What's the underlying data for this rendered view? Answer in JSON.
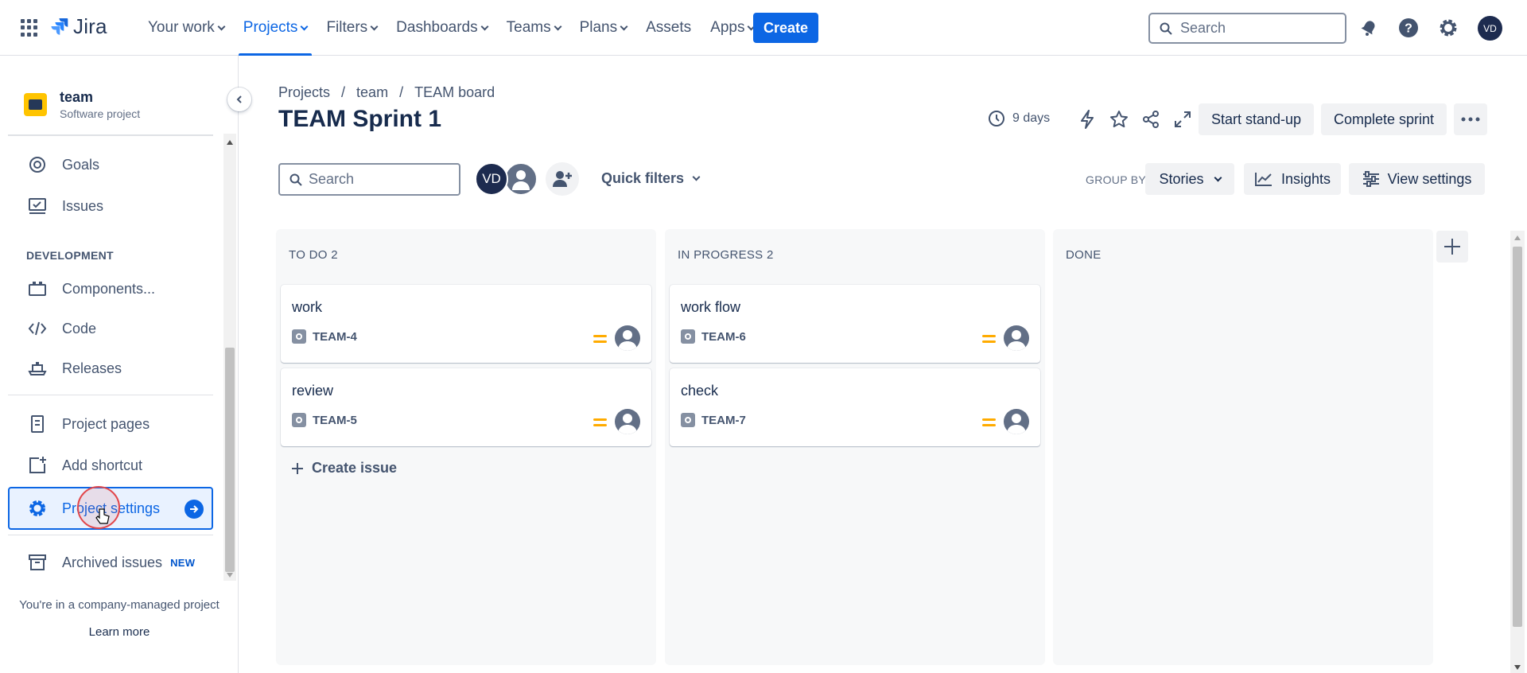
{
  "topnav": {
    "product": "Jira",
    "items": [
      {
        "label": "Your work",
        "dropdown": true
      },
      {
        "label": "Projects",
        "dropdown": true,
        "active": true
      },
      {
        "label": "Filters",
        "dropdown": true
      },
      {
        "label": "Dashboards",
        "dropdown": true
      },
      {
        "label": "Teams",
        "dropdown": true
      },
      {
        "label": "Plans",
        "dropdown": true
      },
      {
        "label": "Assets",
        "dropdown": false
      },
      {
        "label": "Apps",
        "dropdown": true
      }
    ],
    "create_label": "Create",
    "search_placeholder": "Search",
    "user_initials": "VD",
    "accent": "#0c66e4"
  },
  "sidebar": {
    "project_name": "team",
    "project_type": "Software project",
    "items_top": [
      {
        "label": "Goals",
        "icon": "target-icon"
      },
      {
        "label": "Issues",
        "icon": "issues-icon"
      }
    ],
    "development_heading": "DEVELOPMENT",
    "items_dev": [
      {
        "label": "Components...",
        "icon": "components-icon"
      },
      {
        "label": "Code",
        "icon": "code-icon"
      },
      {
        "label": "Releases",
        "icon": "releases-icon"
      }
    ],
    "items_bottom": [
      {
        "label": "Project pages",
        "icon": "pages-icon"
      },
      {
        "label": "Add shortcut",
        "icon": "add-shortcut-icon"
      },
      {
        "label": "Project settings",
        "icon": "gear-icon",
        "selected": true
      },
      {
        "label": "Archived issues",
        "icon": "archive-icon",
        "badge": "NEW"
      }
    ],
    "footer_text": "You're in a company-managed project",
    "learn_more": "Learn more"
  },
  "board": {
    "breadcrumb": [
      "Projects",
      "team",
      "TEAM board"
    ],
    "title": "TEAM Sprint 1",
    "days_remaining": "9 days",
    "start_standup": "Start stand-up",
    "complete_sprint": "Complete sprint",
    "search_placeholder": "Search",
    "avatar_initials": "VD",
    "quick_filters": "Quick filters",
    "group_by_label": "GROUP BY",
    "group_by_value": "Stories",
    "insights": "Insights",
    "view_settings": "View settings",
    "create_issue": "Create issue",
    "columns": [
      {
        "title": "TO DO 2",
        "cards": [
          {
            "summary": "work",
            "key": "TEAM-4"
          },
          {
            "summary": "review",
            "key": "TEAM-5"
          }
        ]
      },
      {
        "title": "IN PROGRESS 2",
        "cards": [
          {
            "summary": "work flow",
            "key": "TEAM-6"
          },
          {
            "summary": "check",
            "key": "TEAM-7"
          }
        ]
      },
      {
        "title": "DONE",
        "cards": []
      }
    ],
    "priority_color": "#ffab00"
  }
}
